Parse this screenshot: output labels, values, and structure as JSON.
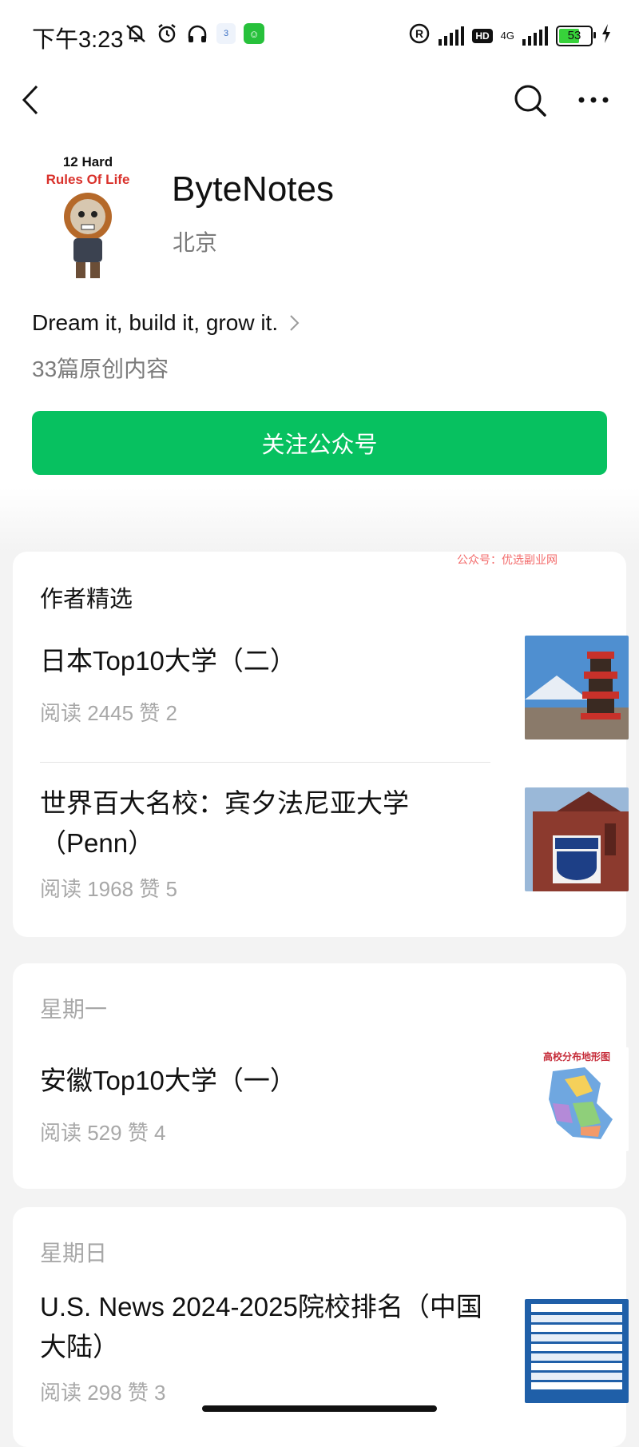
{
  "status_bar": {
    "time": "下午3:23",
    "app_badge_1": "3",
    "network": "4G",
    "hd": "HD",
    "battery": "53"
  },
  "icons": {
    "back": "chevron-left-icon",
    "search": "search-icon",
    "more": "more-icon",
    "slogan_arrow": "chevron-right-icon"
  },
  "profile": {
    "avatar_text_1": "12 Hard",
    "avatar_text_2": "Rules Of Life",
    "name": "ByteNotes",
    "location": "北京",
    "slogan": "Dream it, build it, grow it.",
    "original_count": "33篇原创内容",
    "follow_label": "关注公众号"
  },
  "colors": {
    "accent_green": "#07c160",
    "meta_gray": "#a8a8a8",
    "watermark_red": "#f36b6b"
  },
  "watermark": "公众号：优选副业网",
  "featured": {
    "title": "作者精选",
    "articles": [
      {
        "title": "日本Top10大学（二）",
        "meta": "阅读 2445   赞 2"
      },
      {
        "title": "世界百大名校：宾夕法尼亚大学（Penn）",
        "meta": "阅读 1968   赞 5"
      }
    ]
  },
  "monday": {
    "title": "星期一",
    "article": {
      "title": "安徽Top10大学（一）",
      "meta": "阅读 529   赞 4",
      "thumb_caption": "高校分布地形图"
    }
  },
  "sunday": {
    "title": "星期日",
    "article": {
      "title": "U.S. News 2024-2025院校排名（中国大陆）",
      "meta": "阅读 298   赞 3"
    }
  }
}
